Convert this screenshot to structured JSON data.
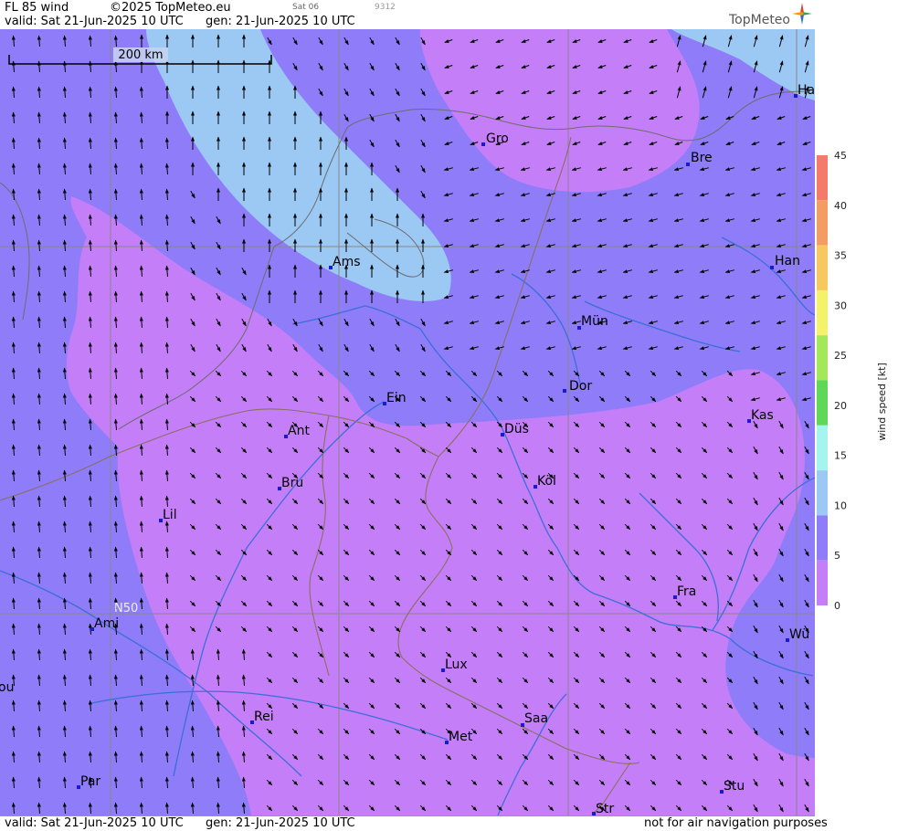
{
  "header": {
    "title": "FL 85 wind",
    "copyright": "©2025 TopMeteo.eu",
    "sat": "Sat 06",
    "code": "9312",
    "valid": "valid:  Sat  21-Jun-2025  10 UTC",
    "gen": "gen: 21-Jun-2025 10 UTC",
    "brand": "TopMeteo"
  },
  "footer": {
    "valid": "valid:  Sat  21-Jun-2025  10 UTC",
    "gen": "gen: 21-Jun-2025 10 UTC",
    "disclaimer": "not for air navigation purposes"
  },
  "map": {
    "scale_label": "200 km",
    "lat_label": "N50",
    "cities": [
      {
        "name": "Gro"
      },
      {
        "name": "Bre"
      },
      {
        "name": "Ha"
      },
      {
        "name": "Ams"
      },
      {
        "name": "Han"
      },
      {
        "name": "Mün"
      },
      {
        "name": "Ein"
      },
      {
        "name": "Dor"
      },
      {
        "name": "Kas"
      },
      {
        "name": "Ant"
      },
      {
        "name": "Düs"
      },
      {
        "name": "Bru"
      },
      {
        "name": "Köl"
      },
      {
        "name": "Lil"
      },
      {
        "name": "Fra"
      },
      {
        "name": "Ami"
      },
      {
        "name": "Wü"
      },
      {
        "name": "ou"
      },
      {
        "name": "Lux"
      },
      {
        "name": "Rei"
      },
      {
        "name": "Saa"
      },
      {
        "name": "Met"
      },
      {
        "name": "Par"
      },
      {
        "name": "Stu"
      },
      {
        "name": "Str"
      }
    ],
    "colors": {
      "kt_0_5": "#c47ef8",
      "kt_5_10": "#8e7cf8",
      "kt_10_15": "#9cc8f4",
      "city_marker": "#1a1ad0",
      "river": "#3d6fd8",
      "border": "#8a7060"
    }
  },
  "legend": {
    "title": "wind speed [kt]",
    "ticks": [
      "45",
      "40",
      "35",
      "30",
      "25",
      "20",
      "15",
      "10",
      "5",
      "0"
    ],
    "colors": [
      "#f47a6a",
      "#f49d62",
      "#f7c760",
      "#f4f26a",
      "#a4e75a",
      "#5fd85a",
      "#a6f4f0",
      "#9cc8f4",
      "#8e7cf8",
      "#c47ef8"
    ]
  }
}
